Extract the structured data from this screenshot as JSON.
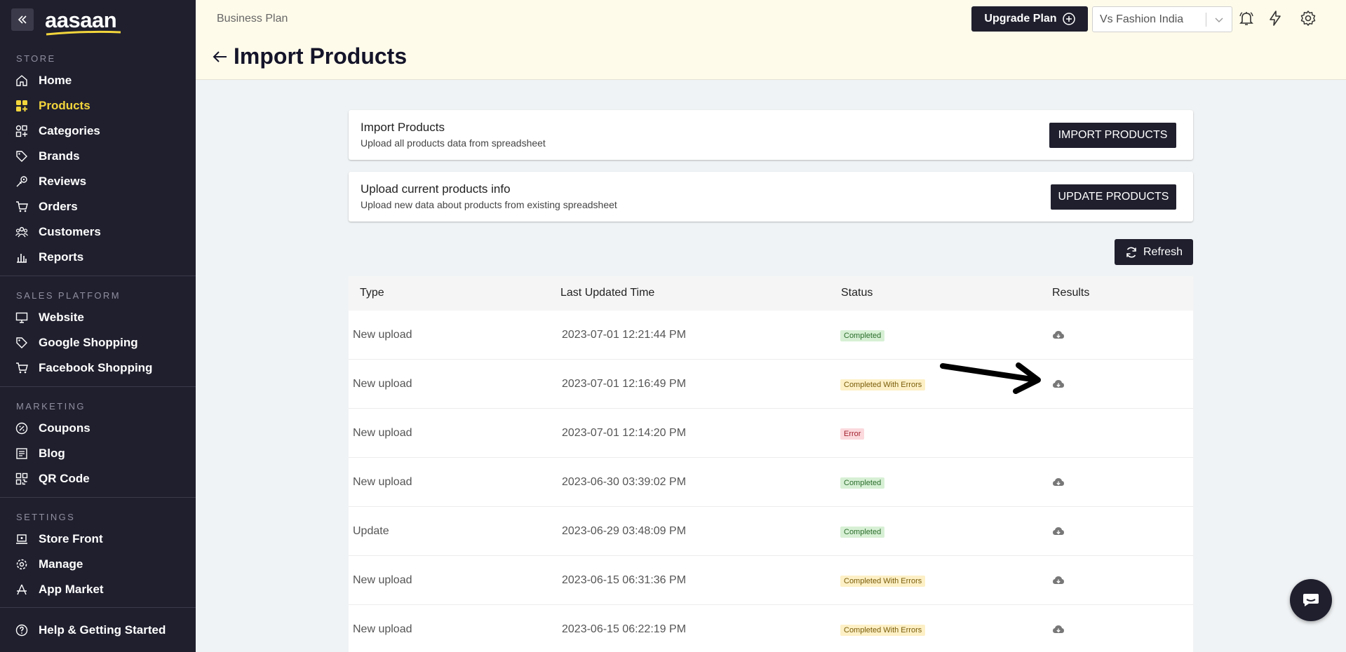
{
  "sidebar": {
    "logo": "aasaan",
    "sections": {
      "store": "STORE",
      "sales": "SALES PLATFORM",
      "marketing": "MARKETING",
      "settings": "SETTINGS"
    },
    "items": {
      "home": "Home",
      "products": "Products",
      "categories": "Categories",
      "brands": "Brands",
      "reviews": "Reviews",
      "orders": "Orders",
      "customers": "Customers",
      "reports": "Reports",
      "website": "Website",
      "google": "Google Shopping",
      "facebook": "Facebook Shopping",
      "coupons": "Coupons",
      "blog": "Blog",
      "qr": "QR Code",
      "storefront": "Store Front",
      "manage": "Manage",
      "appmarket": "App Market",
      "help": "Help & Getting Started"
    },
    "active_color": "#f2d53c"
  },
  "header": {
    "plan": "Business Plan",
    "title": "Import Products",
    "upgrade_label": "Upgrade Plan",
    "store_name": "Vs Fashion India"
  },
  "cards": {
    "import": {
      "title": "Import Products",
      "subtitle": "Upload all products data from spreadsheet",
      "button": "IMPORT PRODUCTS"
    },
    "update": {
      "title": "Upload current products info",
      "subtitle": "Upload new data about products from existing spreadsheet",
      "button": "UPDATE PRODUCTS"
    }
  },
  "refresh_label": "Refresh",
  "table": {
    "headers": {
      "type": "Type",
      "time": "Last Updated Time",
      "status": "Status",
      "results": "Results"
    },
    "rows": [
      {
        "type": "New upload",
        "time": "2023-07-01 12:21:44 PM",
        "status": "Completed"
      },
      {
        "type": "New upload",
        "time": "2023-07-01 12:16:49 PM",
        "status": "Completed With Errors"
      },
      {
        "type": "New upload",
        "time": "2023-07-01 12:14:20 PM",
        "status": "Error"
      },
      {
        "type": "New upload",
        "time": "2023-06-30 03:39:02 PM",
        "status": "Completed"
      },
      {
        "type": "Update",
        "time": "2023-06-29 03:48:09 PM",
        "status": "Completed"
      },
      {
        "type": "New upload",
        "time": "2023-06-15 06:31:36 PM",
        "status": "Completed With Errors"
      },
      {
        "type": "New upload",
        "time": "2023-06-15 06:22:19 PM",
        "status": "Completed With Errors"
      }
    ]
  }
}
